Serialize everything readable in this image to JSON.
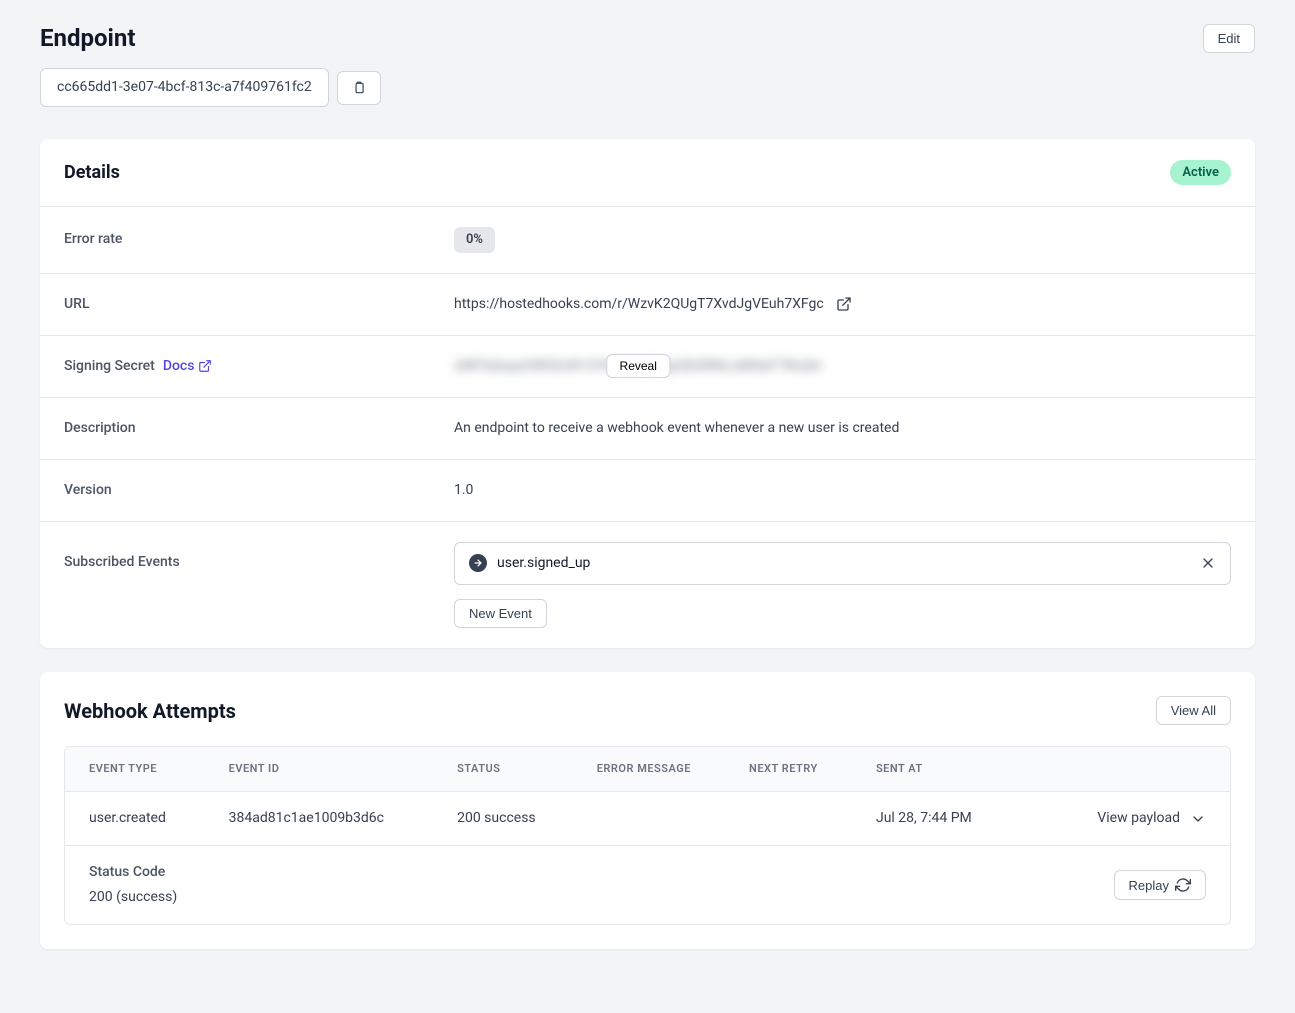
{
  "header": {
    "title": "Endpoint",
    "edit_label": "Edit",
    "endpoint_id": "cc665dd1-3e07-4bcf-813c-a7f409761fc2"
  },
  "details": {
    "title": "Details",
    "status_badge": "Active",
    "labels": {
      "error_rate": "Error rate",
      "url": "URL",
      "signing_secret": "Signing Secret",
      "docs": "Docs",
      "description": "Description",
      "version": "Version",
      "subscribed_events": "Subscribed Events"
    },
    "values": {
      "error_rate": "0%",
      "url": "https://hostedhooks.com/r/WzvK2QUgT7XvdJgVEuh7XFgc",
      "signing_secret_masked": "xNP3daqa2WhDxN13Y8vKmZ3Qp5b0RNLxM8aF7Wu8n",
      "reveal_label": "Reveal",
      "description": "An endpoint to receive a webhook event whenever a new user is created",
      "version": "1.0"
    },
    "subscribed_events": [
      {
        "name": "user.signed_up"
      }
    ],
    "new_event_label": "New Event"
  },
  "attempts": {
    "title": "Webhook Attempts",
    "view_all_label": "View All",
    "columns": {
      "event_type": "Event Type",
      "event_id": "Event ID",
      "status": "Status",
      "error_message": "Error Message",
      "next_retry": "Next Retry",
      "sent_at": "Sent At"
    },
    "rows": [
      {
        "event_type": "user.created",
        "event_id": "384ad81c1ae1009b3d6c",
        "status": "200 success",
        "error_message": "",
        "next_retry": "",
        "sent_at": "Jul 28, 7:44 PM",
        "view_payload_label": "View payload"
      }
    ],
    "expanded": {
      "status_code_label": "Status Code",
      "status_code_value": "200 (success)",
      "replay_label": "Replay"
    }
  }
}
